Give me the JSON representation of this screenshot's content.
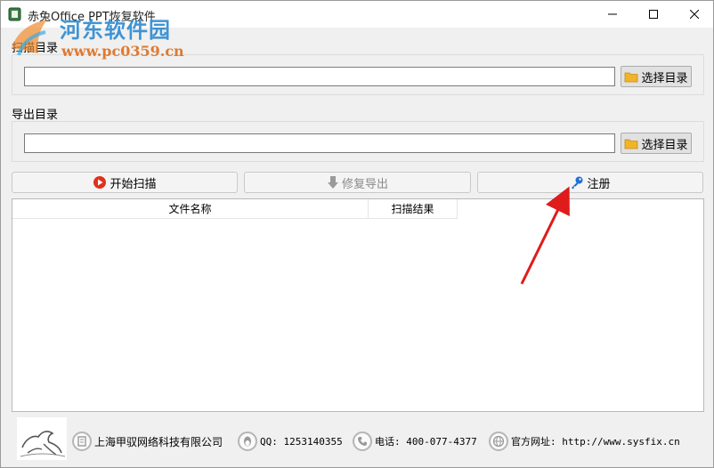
{
  "window": {
    "title": "赤兔Office PPT恢复软件",
    "controls": {
      "minimize": "–",
      "maximize": "☐",
      "close": "✕"
    }
  },
  "watermark": {
    "title": "河东软件园",
    "url": "www.pc0359.cn"
  },
  "scan": {
    "label": "扫描目录",
    "path_value": "",
    "browse_label": "选择目录"
  },
  "export": {
    "label": "导出目录",
    "path_value": "",
    "browse_label": "选择目录"
  },
  "actions": {
    "start_scan": "开始扫描",
    "repair_export": "修复导出",
    "register": "注册"
  },
  "table": {
    "columns": [
      "文件名称",
      "扫描结果"
    ],
    "rows": []
  },
  "footer": {
    "company": "上海甲驭网络科技有限公司",
    "qq": "QQ: 1253140355",
    "phone": "电话: 400-077-4377",
    "website": "官方网址: http://www.sysfix.cn"
  },
  "colors": {
    "window_bg": "#f0f0f0",
    "play_icon": "#e0321b",
    "folder_icon": "#f0b429",
    "key_icon": "#1e6fd9",
    "annotation_arrow": "#e01b1b",
    "watermark_title": "#2c8ad0",
    "watermark_url": "#e06d1a"
  },
  "icons": {
    "app": "app-icon",
    "browse": "folder-icon",
    "start_scan": "play-icon",
    "repair_export": "download-arrow-icon",
    "register": "key-icon",
    "company": "company-icon",
    "qq": "qq-penguin-icon",
    "phone": "phone-icon",
    "website": "globe-icon"
  }
}
